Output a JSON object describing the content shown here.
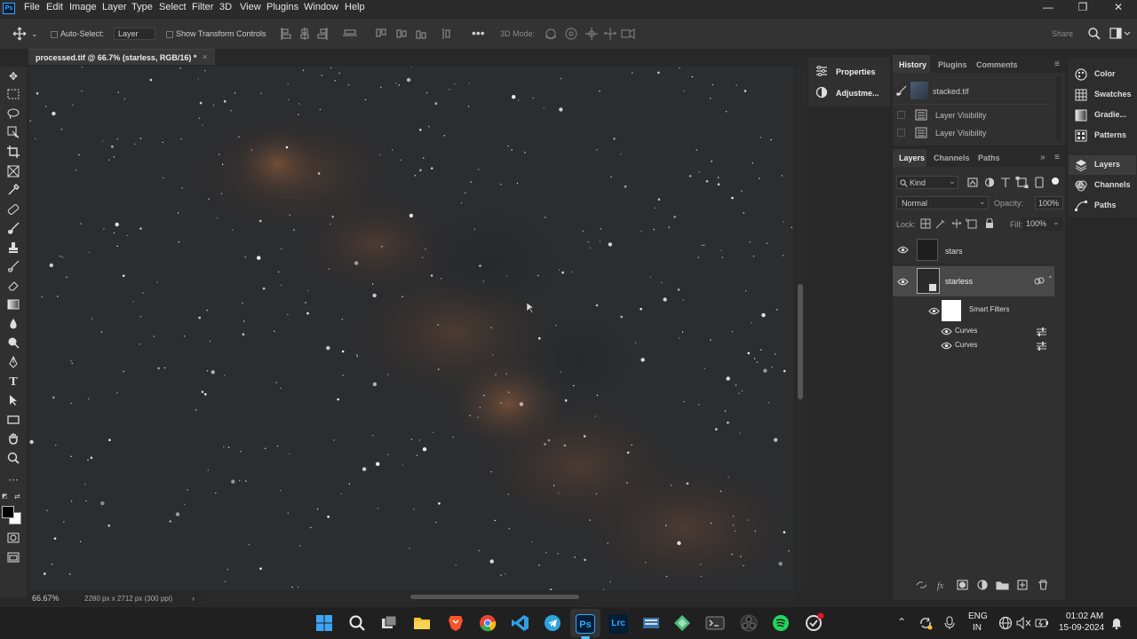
{
  "menubar": {
    "logo": "Ps",
    "items": [
      "File",
      "Edit",
      "Image",
      "Layer",
      "Type",
      "Select",
      "Filter",
      "3D",
      "View",
      "Plugins",
      "Window",
      "Help"
    ]
  },
  "window_controls": {
    "minimize": "—",
    "restore": "❐",
    "close": "✕"
  },
  "options": {
    "auto_select_label": "Auto-Select:",
    "auto_select_value": "Layer",
    "transform_label": "Show Transform Controls",
    "mode_3d_label": "3D Mode:",
    "share_label": "Share"
  },
  "document": {
    "tab_title": "processed.tif @ 66.7% (starless, RGB/16) *",
    "zoom": "66.67%",
    "dimensions": "2280 px x 2712 px (300 ppi)"
  },
  "properties_panel": {
    "items": [
      "Properties",
      "Adjustme..."
    ]
  },
  "history_panel": {
    "tabs": [
      "History",
      "Plugins",
      "Comments"
    ],
    "source": "stacked.tif",
    "steps": [
      "Layer Visibility",
      "Layer Visibility"
    ]
  },
  "layers_panel": {
    "tabs": [
      "Layers",
      "Channels",
      "Paths"
    ],
    "filter_kind": "Kind",
    "blend_mode": "Normal",
    "opacity_label": "Opacity:",
    "opacity_value": "100%",
    "lock_label": "Lock:",
    "fill_label": "Fill:",
    "fill_value": "100%",
    "layers": [
      {
        "name": "stars"
      },
      {
        "name": "starless"
      }
    ],
    "smart_filters_label": "Smart Filters",
    "filters": [
      "Curves",
      "Curves"
    ]
  },
  "right_dock": {
    "items": [
      {
        "label": "Color",
        "icon": "color-icon"
      },
      {
        "label": "Swatches",
        "icon": "swatches-icon"
      },
      {
        "label": "Gradie...",
        "icon": "gradients-icon"
      },
      {
        "label": "Patterns",
        "icon": "patterns-icon"
      },
      {
        "label": "Layers",
        "icon": "layers-icon"
      },
      {
        "label": "Channels",
        "icon": "channels-icon"
      },
      {
        "label": "Paths",
        "icon": "paths-icon"
      }
    ]
  },
  "taskbar": {
    "apps": [
      "start-icon",
      "search-icon",
      "task-view-icon",
      "file-explorer-icon",
      "brave-icon",
      "chrome-icon",
      "vscode-icon",
      "telegram-icon",
      "photoshop-icon",
      "lightroom-classic-icon",
      "app-icon",
      "app-icon",
      "terminal-icon",
      "obs-icon",
      "spotify-icon",
      "app-icon"
    ],
    "ps_label": "Ps",
    "lrc_label": "Lrc",
    "lang_top": "ENG",
    "lang_bottom": "IN",
    "time": "01:02 AM",
    "date": "15-09-2024"
  },
  "colors": {
    "accent": "#31a8ff",
    "panel": "#303030",
    "canvas": "#2a2b2d"
  }
}
